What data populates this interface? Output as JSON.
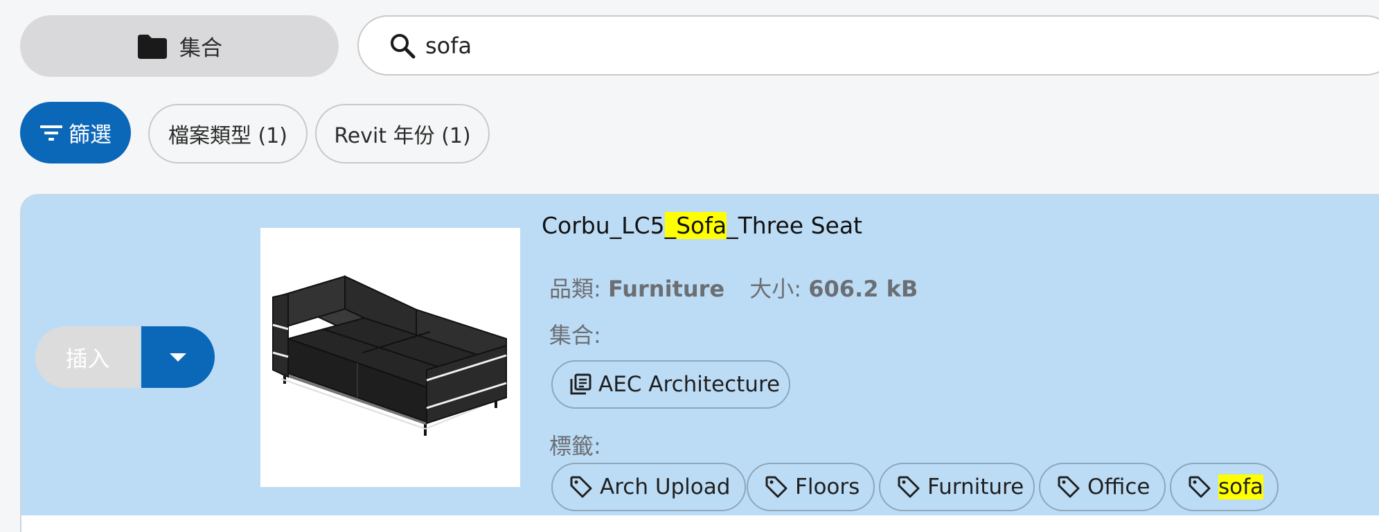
{
  "header": {
    "collections_label": "集合",
    "search_value": "sofa"
  },
  "filters": {
    "filter_label": "篩選",
    "chips": [
      {
        "label": "檔案類型 (1)"
      },
      {
        "label": "Revit 年份 (1)"
      }
    ]
  },
  "result": {
    "insert_label": "插入",
    "title_prefix": "Corbu_LC5",
    "title_highlight": "_Sofa",
    "title_suffix": "_Three Seat",
    "category_label": "品類:",
    "category_value": "Furniture",
    "size_label": "大小:",
    "size_value": "606.2 kB",
    "collections_label": "集合:",
    "collections": [
      "AEC Architecture"
    ],
    "tags_label": "標籤:",
    "tags": [
      "Arch Upload",
      "Floors",
      "Furniture",
      "Office",
      "sofa"
    ]
  },
  "colors": {
    "accent": "#0b67b8",
    "card_background": "#bcdcf5",
    "highlight": "#ffff00"
  },
  "icons": [
    "folder-icon",
    "search-icon",
    "filter-icon",
    "chevron-down-icon",
    "library-icon",
    "tag-icon"
  ]
}
